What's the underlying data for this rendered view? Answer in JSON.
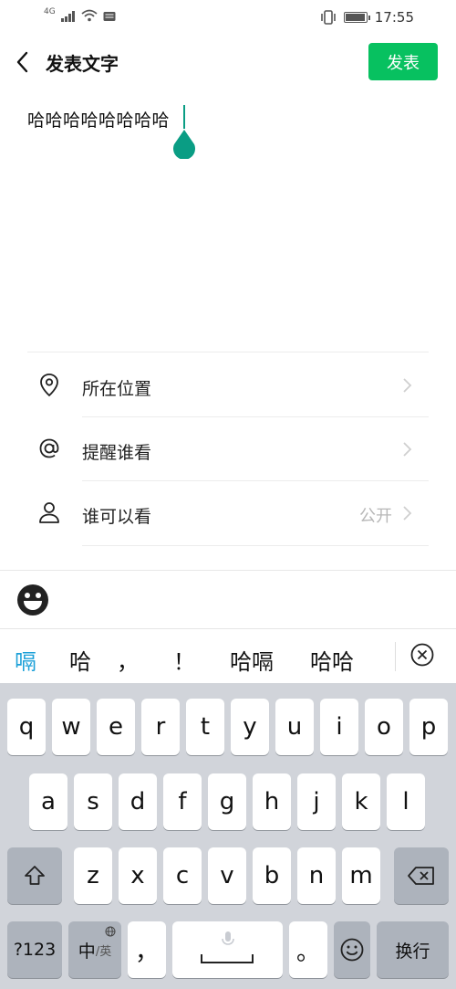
{
  "status_bar": {
    "signal_label": "4G",
    "time": "17:55"
  },
  "header": {
    "title": "发表文字",
    "publish_label": "发表"
  },
  "composer": {
    "text": "哈哈哈哈哈哈哈哈"
  },
  "options": [
    {
      "label": "所在位置",
      "icon": "location-pin-icon",
      "value": ""
    },
    {
      "label": "提醒谁看",
      "icon": "at-sign-icon",
      "value": ""
    },
    {
      "label": "谁可以看",
      "icon": "person-icon",
      "value": "公开"
    }
  ],
  "candidates": [
    "嗝",
    "哈",
    "，",
    "！",
    "哈嗝",
    "哈哈"
  ],
  "keyboard": {
    "row1": [
      "q",
      "w",
      "e",
      "r",
      "t",
      "y",
      "u",
      "i",
      "o",
      "p"
    ],
    "row2": [
      "a",
      "s",
      "d",
      "f",
      "g",
      "h",
      "j",
      "k",
      "l"
    ],
    "row3": [
      "z",
      "x",
      "c",
      "v",
      "b",
      "n",
      "m"
    ],
    "num_label": "?123",
    "lang_label_main": "中",
    "lang_label_sub": "/英",
    "comma": "，",
    "period": "。",
    "enter_label": "换行"
  },
  "colors": {
    "accent_green": "#07c160",
    "candidate_blue": "#1ba0d8",
    "cursor_teal": "#0a9d84"
  }
}
